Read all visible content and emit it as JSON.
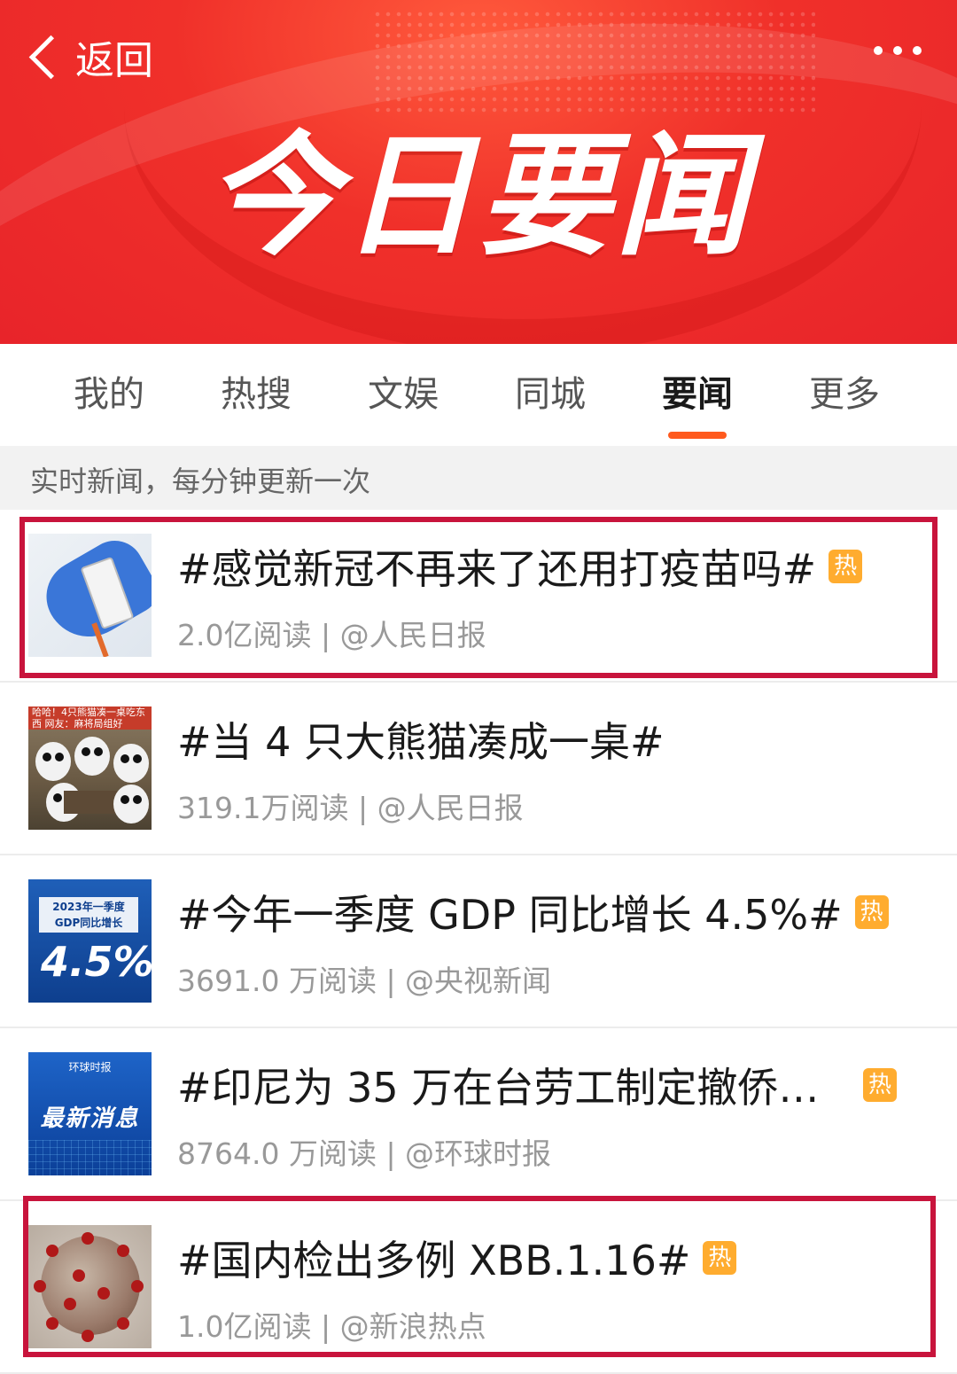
{
  "header": {
    "back_label": "返回",
    "banner_title": "今日要闻"
  },
  "tabs": [
    {
      "label": "我的"
    },
    {
      "label": "热搜"
    },
    {
      "label": "文娱"
    },
    {
      "label": "同城"
    },
    {
      "label": "要闻",
      "active": true
    },
    {
      "label": "更多"
    }
  ],
  "notice": "实时新闻，每分钟更新一次",
  "hot_badge": "热",
  "items": [
    {
      "title": "#感觉新冠不再来了还用打疫苗吗#",
      "meta": "2.0亿阅读 | @人民日报",
      "hot": true,
      "thumb": "vaccine",
      "highlighted": true
    },
    {
      "title": "#当 4 只大熊猫凑成一桌#",
      "meta": "319.1万阅读 | @人民日报",
      "hot": false,
      "thumb": "panda",
      "thumb_caption": "哈哈！4只熊猫凑一桌吃东西 网友：麻将局组好",
      "highlighted": false
    },
    {
      "title": "#今年一季度 GDP 同比增长 4.5%#",
      "meta": "3691.0 万阅读 | @央视新闻",
      "hot": true,
      "thumb": "gdp",
      "thumb_box": "2023年一季度 GDP同比增长",
      "thumb_value": "4.5%",
      "highlighted": false
    },
    {
      "title": "#印尼为 35 万在台劳工制定撤侨计...",
      "meta": "8764.0 万阅读 | @环球时报",
      "hot": true,
      "thumb": "news",
      "thumb_brand": "环球时报",
      "thumb_label": "最新消息",
      "highlighted": false
    },
    {
      "title": "#国内检出多例 XBB.1.16#",
      "meta": "1.0亿阅读 | @新浪热点",
      "hot": true,
      "thumb": "virus",
      "highlighted": true
    }
  ],
  "colors": {
    "header_red": "#f0302a",
    "tab_underline": "#ff5a1e",
    "hot_badge": "#ffac2f",
    "highlight_border": "#c8143c"
  }
}
